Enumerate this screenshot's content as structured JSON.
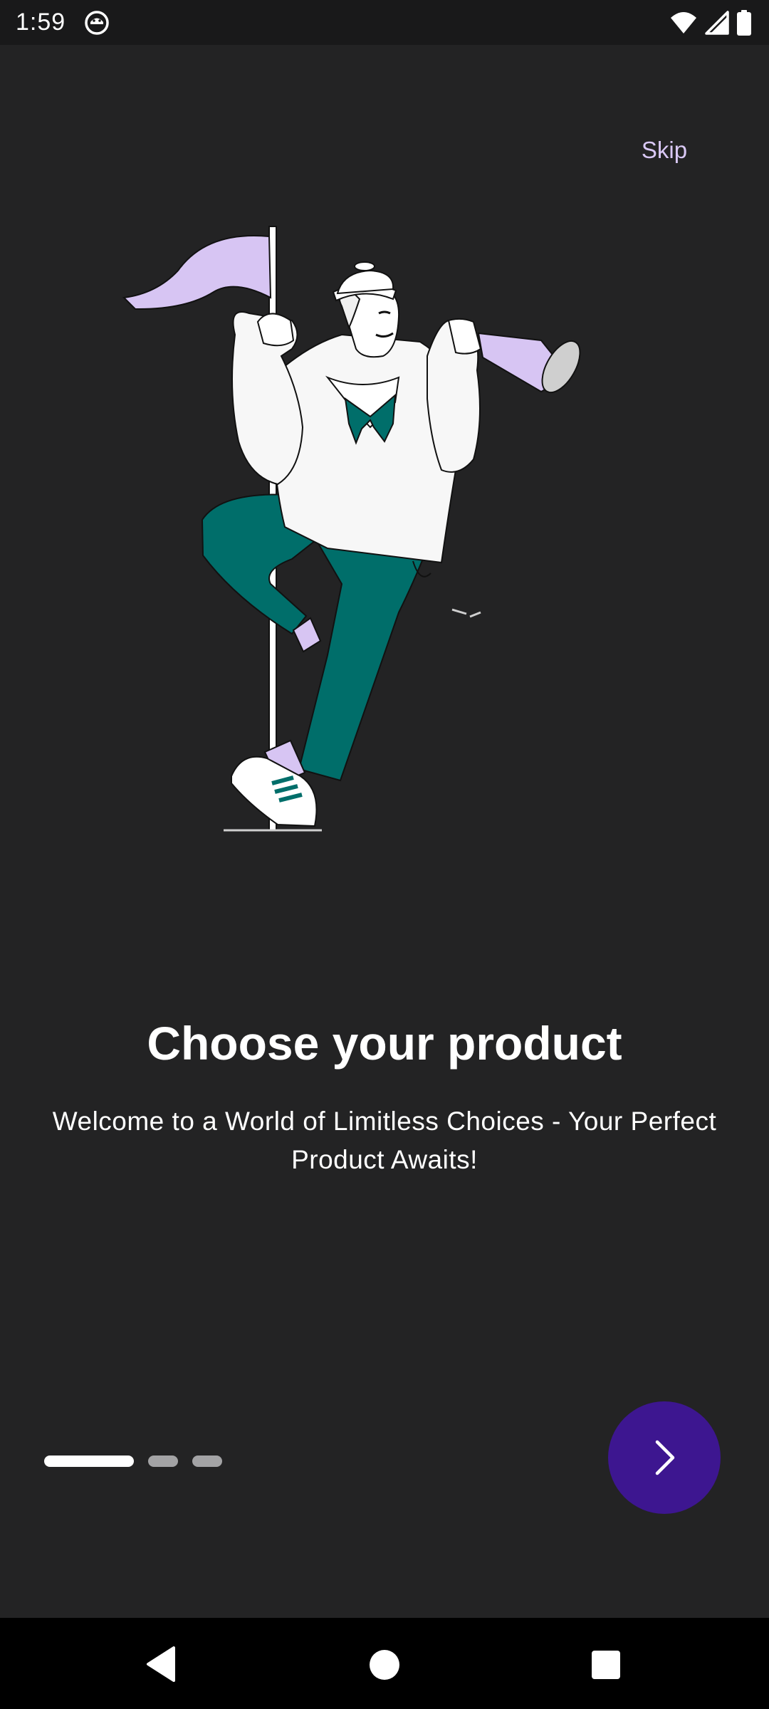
{
  "status_bar": {
    "time": "1:59",
    "app_icon": "app-notification-icon",
    "icons": [
      "wifi-icon",
      "signal-icon",
      "battery-icon"
    ]
  },
  "onboarding": {
    "skip_label": "Skip",
    "illustration": "sailor-with-flag-and-telescope",
    "title": "Choose your product",
    "subtitle": "Welcome to a World of Limitless Choices - Your Perfect Product Awaits!",
    "page_indicator": {
      "total": 3,
      "current": 1
    },
    "next_icon": "chevron-right-icon"
  },
  "colors": {
    "background": "#232324",
    "accent_button": "#3d1690",
    "skip_text": "#d9c8f5",
    "illustration_lavender": "#d7c5f3",
    "illustration_teal": "#006e6a"
  },
  "nav_bar": {
    "buttons": [
      "back-icon",
      "home-icon",
      "recents-icon"
    ]
  }
}
